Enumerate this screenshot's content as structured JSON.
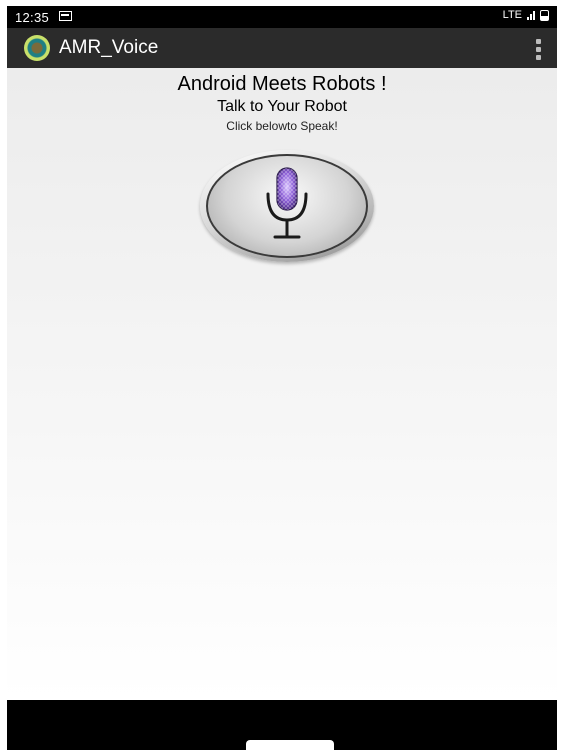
{
  "status_bar": {
    "time": "12:35",
    "network": "LTE",
    "icons": [
      "notification-icon",
      "signal-icon",
      "battery-icon"
    ]
  },
  "action_bar": {
    "app_icon": "app-logo-icon",
    "title": "AMR_Voice",
    "menu_icon": "overflow-menu-icon"
  },
  "main": {
    "headline": "Android Meets Robots !",
    "subhead": "Talk to Your Robot",
    "hint": "Click belowto Speak!",
    "mic_icon": "microphone-icon"
  },
  "colors": {
    "status_bar": "#000000",
    "action_bar": "#2b2b2b",
    "content_bg": "#f2f2f2",
    "mic_accent": "#8a5cd6"
  }
}
